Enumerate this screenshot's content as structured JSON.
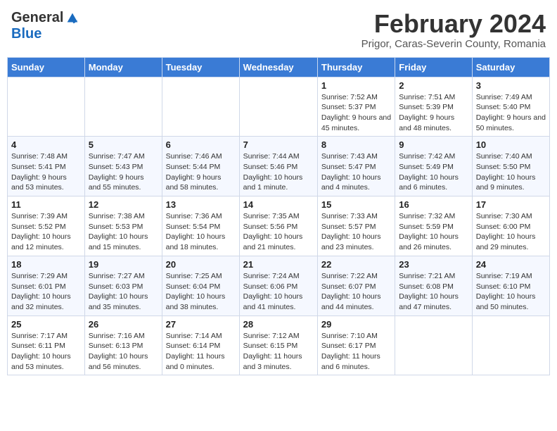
{
  "header": {
    "logo_general": "General",
    "logo_blue": "Blue",
    "month_title": "February 2024",
    "subtitle": "Prigor, Caras-Severin County, Romania"
  },
  "days_of_week": [
    "Sunday",
    "Monday",
    "Tuesday",
    "Wednesday",
    "Thursday",
    "Friday",
    "Saturday"
  ],
  "weeks": [
    [
      {
        "day": "",
        "info": ""
      },
      {
        "day": "",
        "info": ""
      },
      {
        "day": "",
        "info": ""
      },
      {
        "day": "",
        "info": ""
      },
      {
        "day": "1",
        "info": "Sunrise: 7:52 AM\nSunset: 5:37 PM\nDaylight: 9 hours and 45 minutes."
      },
      {
        "day": "2",
        "info": "Sunrise: 7:51 AM\nSunset: 5:39 PM\nDaylight: 9 hours and 48 minutes."
      },
      {
        "day": "3",
        "info": "Sunrise: 7:49 AM\nSunset: 5:40 PM\nDaylight: 9 hours and 50 minutes."
      }
    ],
    [
      {
        "day": "4",
        "info": "Sunrise: 7:48 AM\nSunset: 5:41 PM\nDaylight: 9 hours and 53 minutes."
      },
      {
        "day": "5",
        "info": "Sunrise: 7:47 AM\nSunset: 5:43 PM\nDaylight: 9 hours and 55 minutes."
      },
      {
        "day": "6",
        "info": "Sunrise: 7:46 AM\nSunset: 5:44 PM\nDaylight: 9 hours and 58 minutes."
      },
      {
        "day": "7",
        "info": "Sunrise: 7:44 AM\nSunset: 5:46 PM\nDaylight: 10 hours and 1 minute."
      },
      {
        "day": "8",
        "info": "Sunrise: 7:43 AM\nSunset: 5:47 PM\nDaylight: 10 hours and 4 minutes."
      },
      {
        "day": "9",
        "info": "Sunrise: 7:42 AM\nSunset: 5:49 PM\nDaylight: 10 hours and 6 minutes."
      },
      {
        "day": "10",
        "info": "Sunrise: 7:40 AM\nSunset: 5:50 PM\nDaylight: 10 hours and 9 minutes."
      }
    ],
    [
      {
        "day": "11",
        "info": "Sunrise: 7:39 AM\nSunset: 5:52 PM\nDaylight: 10 hours and 12 minutes."
      },
      {
        "day": "12",
        "info": "Sunrise: 7:38 AM\nSunset: 5:53 PM\nDaylight: 10 hours and 15 minutes."
      },
      {
        "day": "13",
        "info": "Sunrise: 7:36 AM\nSunset: 5:54 PM\nDaylight: 10 hours and 18 minutes."
      },
      {
        "day": "14",
        "info": "Sunrise: 7:35 AM\nSunset: 5:56 PM\nDaylight: 10 hours and 21 minutes."
      },
      {
        "day": "15",
        "info": "Sunrise: 7:33 AM\nSunset: 5:57 PM\nDaylight: 10 hours and 23 minutes."
      },
      {
        "day": "16",
        "info": "Sunrise: 7:32 AM\nSunset: 5:59 PM\nDaylight: 10 hours and 26 minutes."
      },
      {
        "day": "17",
        "info": "Sunrise: 7:30 AM\nSunset: 6:00 PM\nDaylight: 10 hours and 29 minutes."
      }
    ],
    [
      {
        "day": "18",
        "info": "Sunrise: 7:29 AM\nSunset: 6:01 PM\nDaylight: 10 hours and 32 minutes."
      },
      {
        "day": "19",
        "info": "Sunrise: 7:27 AM\nSunset: 6:03 PM\nDaylight: 10 hours and 35 minutes."
      },
      {
        "day": "20",
        "info": "Sunrise: 7:25 AM\nSunset: 6:04 PM\nDaylight: 10 hours and 38 minutes."
      },
      {
        "day": "21",
        "info": "Sunrise: 7:24 AM\nSunset: 6:06 PM\nDaylight: 10 hours and 41 minutes."
      },
      {
        "day": "22",
        "info": "Sunrise: 7:22 AM\nSunset: 6:07 PM\nDaylight: 10 hours and 44 minutes."
      },
      {
        "day": "23",
        "info": "Sunrise: 7:21 AM\nSunset: 6:08 PM\nDaylight: 10 hours and 47 minutes."
      },
      {
        "day": "24",
        "info": "Sunrise: 7:19 AM\nSunset: 6:10 PM\nDaylight: 10 hours and 50 minutes."
      }
    ],
    [
      {
        "day": "25",
        "info": "Sunrise: 7:17 AM\nSunset: 6:11 PM\nDaylight: 10 hours and 53 minutes."
      },
      {
        "day": "26",
        "info": "Sunrise: 7:16 AM\nSunset: 6:13 PM\nDaylight: 10 hours and 56 minutes."
      },
      {
        "day": "27",
        "info": "Sunrise: 7:14 AM\nSunset: 6:14 PM\nDaylight: 11 hours and 0 minutes."
      },
      {
        "day": "28",
        "info": "Sunrise: 7:12 AM\nSunset: 6:15 PM\nDaylight: 11 hours and 3 minutes."
      },
      {
        "day": "29",
        "info": "Sunrise: 7:10 AM\nSunset: 6:17 PM\nDaylight: 11 hours and 6 minutes."
      },
      {
        "day": "",
        "info": ""
      },
      {
        "day": "",
        "info": ""
      }
    ]
  ]
}
